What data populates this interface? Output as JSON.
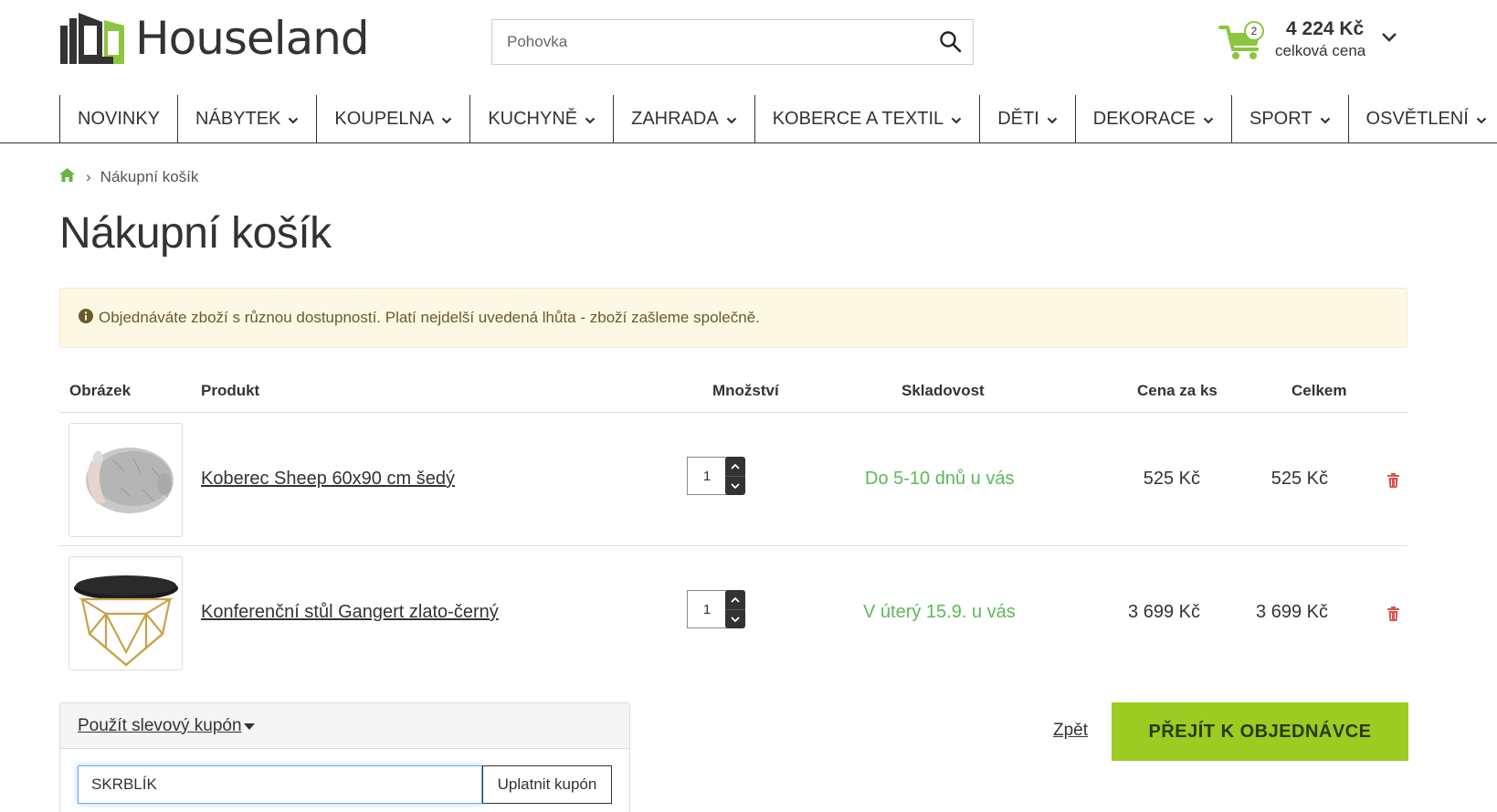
{
  "brand": {
    "name": "Houseland",
    "accent": "#8cc63f",
    "button_green": "#9ccb22"
  },
  "search": {
    "placeholder": "Pohovka",
    "icon": "search-icon"
  },
  "cart": {
    "count": "2",
    "total": "4 224 Kč",
    "label": "celková cena"
  },
  "nav": {
    "items": [
      {
        "label": "NOVINKY",
        "dropdown": false
      },
      {
        "label": "NÁBYTEK",
        "dropdown": true
      },
      {
        "label": "KOUPELNA",
        "dropdown": true
      },
      {
        "label": "KUCHYNĚ",
        "dropdown": true
      },
      {
        "label": "ZAHRADA",
        "dropdown": true
      },
      {
        "label": "KOBERCE A TEXTIL",
        "dropdown": true
      },
      {
        "label": "DĚTI",
        "dropdown": true
      },
      {
        "label": "DEKORACE",
        "dropdown": true
      },
      {
        "label": "SPORT",
        "dropdown": true
      },
      {
        "label": "OSVĚTLENÍ",
        "dropdown": true
      }
    ]
  },
  "breadcrumb": {
    "separator": "›",
    "current": "Nákupní košík"
  },
  "page": {
    "title": "Nákupní košík"
  },
  "alert": {
    "text": "Objednáváte zboží s různou dostupností. Platí nejdelší uvedená lhůta - zboží zašleme společně."
  },
  "table": {
    "headers": {
      "image": "Obrázek",
      "product": "Produkt",
      "quantity": "Množství",
      "stock": "Skladovost",
      "unit_price": "Cena za ks",
      "total": "Celkem"
    },
    "rows": [
      {
        "product": "Koberec Sheep 60x90 cm šedý",
        "quantity": "1",
        "stock": "Do 5-10 dnů u vás",
        "unit_price": "525 Kč",
        "total": "525 Kč"
      },
      {
        "product": "Konferenční stůl Gangert zlato-černý",
        "quantity": "1",
        "stock": "V úterý 15.9. u vás",
        "unit_price": "3 699 Kč",
        "total": "3 699 Kč"
      }
    ]
  },
  "coupon": {
    "toggle_label": "Použít slevový kupón",
    "value": "SKRBLÍK",
    "apply_label": "Uplatnit kupón"
  },
  "actions": {
    "back_label": "Zpět",
    "checkout_label": "PŘEJÍT K OBJEDNÁVCE"
  }
}
